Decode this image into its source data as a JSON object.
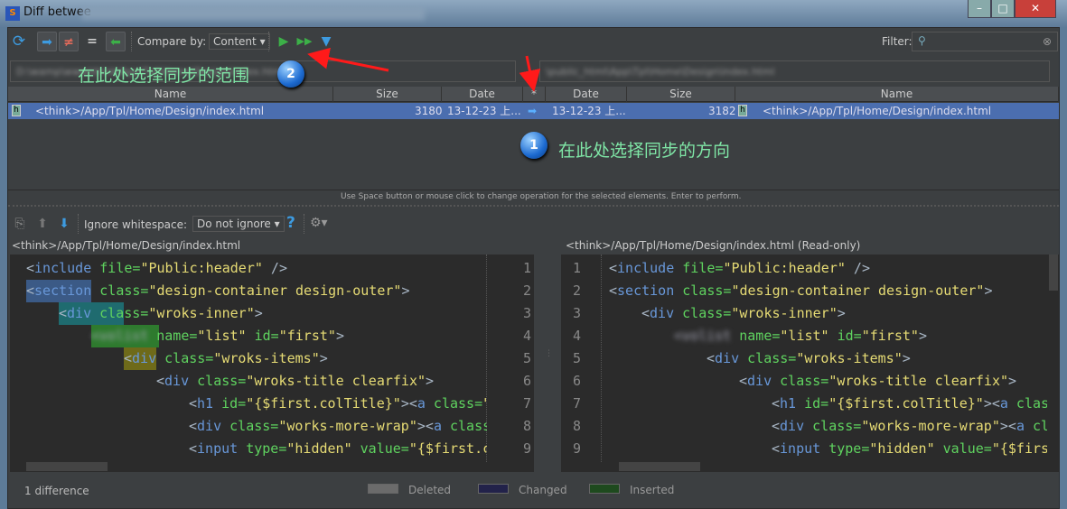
{
  "window": {
    "title": "Diff betwee",
    "controls": {
      "minimize": "–",
      "maximize": "□",
      "close": "✕"
    }
  },
  "toolbar": {
    "compare_by_label": "Compare by:",
    "compare_by_value": "Content",
    "filter_label": "Filter:",
    "filter_value": ""
  },
  "paths": {
    "left": "D:\\wamp\\www\\think\\App\\Tpl\\Home\\Design\\index.html",
    "right": "\\public_html\\App\\Tpl\\Home\\Design\\index.html"
  },
  "table": {
    "headers": {
      "left_name": "Name",
      "left_size": "Size",
      "left_date": "Date",
      "op": "*",
      "right_date": "Date",
      "right_size": "Size",
      "right_name": "Name"
    },
    "rows": [
      {
        "left_name": "<think>/App/Tpl/Home/Design/index.html",
        "left_size": "3180",
        "left_date": "13-12-23 上...",
        "op": "➡",
        "right_date": "13-12-23 上...",
        "right_size": "3182",
        "right_name": "<think>/App/Tpl/Home/Design/index.html"
      }
    ],
    "hint": "Use Space button or mouse click to change operation for the selected elements. Enter to perform."
  },
  "diff_toolbar": {
    "ignore_whitespace_label": "Ignore whitespace:",
    "ignore_whitespace_value": "Do not ignore",
    "help": "?"
  },
  "left_file": "<think>/App/Tpl/Home/Design/index.html",
  "right_file": "<think>/App/Tpl/Home/Design/index.html (Read-only)",
  "code_lines": [
    {
      "n": "1",
      "indent": 0,
      "tokens": [
        [
          "p",
          "<"
        ],
        [
          "n",
          "include"
        ],
        [
          "a",
          " file="
        ],
        [
          "s",
          "\"Public:header\""
        ],
        [
          "p",
          " />"
        ]
      ]
    },
    {
      "n": "2",
      "indent": 0,
      "tokens": [
        [
          "p",
          "<"
        ],
        [
          "n",
          "section"
        ],
        [
          "a",
          " class="
        ],
        [
          "s",
          "\"design-container design-outer\""
        ],
        [
          "p",
          ">"
        ]
      ]
    },
    {
      "n": "3",
      "indent": 1,
      "tokens": [
        [
          "p",
          "<"
        ],
        [
          "n",
          "div"
        ],
        [
          "a",
          " class="
        ],
        [
          "s",
          "\"wroks-inner\""
        ],
        [
          "p",
          ">"
        ]
      ]
    },
    {
      "n": "4",
      "indent": 2,
      "tokens": [
        [
          "b",
          "<volist"
        ],
        [
          "a",
          " name="
        ],
        [
          "s",
          "\"list\""
        ],
        [
          "a",
          " id="
        ],
        [
          "s",
          "\"first\""
        ],
        [
          "p",
          ">"
        ]
      ]
    },
    {
      "n": "5",
      "indent": 3,
      "tokens": [
        [
          "p",
          "<"
        ],
        [
          "n",
          "div"
        ],
        [
          "a",
          " class="
        ],
        [
          "s",
          "\"wroks-items\""
        ],
        [
          "p",
          ">"
        ]
      ]
    },
    {
      "n": "6",
      "indent": 4,
      "tokens": [
        [
          "p",
          "<"
        ],
        [
          "n",
          "div"
        ],
        [
          "a",
          " class="
        ],
        [
          "s",
          "\"wroks-title clearfix\""
        ],
        [
          "p",
          ">"
        ]
      ]
    },
    {
      "n": "7",
      "indent": 5,
      "tokens": [
        [
          "p",
          "<"
        ],
        [
          "n",
          "h1"
        ],
        [
          "a",
          " id="
        ],
        [
          "s",
          "\"{$first.colTitle}\""
        ],
        [
          "p",
          "><"
        ],
        [
          "n",
          "a"
        ],
        [
          "a",
          " class="
        ],
        [
          "s",
          "\""
        ]
      ]
    },
    {
      "n": "8",
      "indent": 5,
      "tokens": [
        [
          "p",
          "<"
        ],
        [
          "n",
          "div"
        ],
        [
          "a",
          " class="
        ],
        [
          "s",
          "\"works-more-wrap\""
        ],
        [
          "p",
          "><"
        ],
        [
          "n",
          "a"
        ],
        [
          "a",
          " class"
        ]
      ]
    },
    {
      "n": "9",
      "indent": 5,
      "tokens": [
        [
          "p",
          "<"
        ],
        [
          "n",
          "input"
        ],
        [
          "a",
          " type="
        ],
        [
          "s",
          "\"hidden\""
        ],
        [
          "a",
          " value="
        ],
        [
          "s",
          "\"{$first.c"
        ]
      ]
    }
  ],
  "status": {
    "differences": "1 difference",
    "legend": [
      {
        "label": "Deleted",
        "color": "#6b6b6b"
      },
      {
        "label": "Changed",
        "color": "#22224a"
      },
      {
        "label": "Inserted",
        "color": "#1e4a1e"
      }
    ]
  },
  "annotations": {
    "range_text": "在此处选择同步的范围",
    "range_num": "2",
    "direction_text": "在此处选择同步的方向",
    "direction_num": "1"
  },
  "colors": {
    "selection": "#4b6eaf",
    "background": "#3c3f41",
    "editor": "#2b2b2b",
    "annotation_arrow": "#ff1a1a"
  }
}
